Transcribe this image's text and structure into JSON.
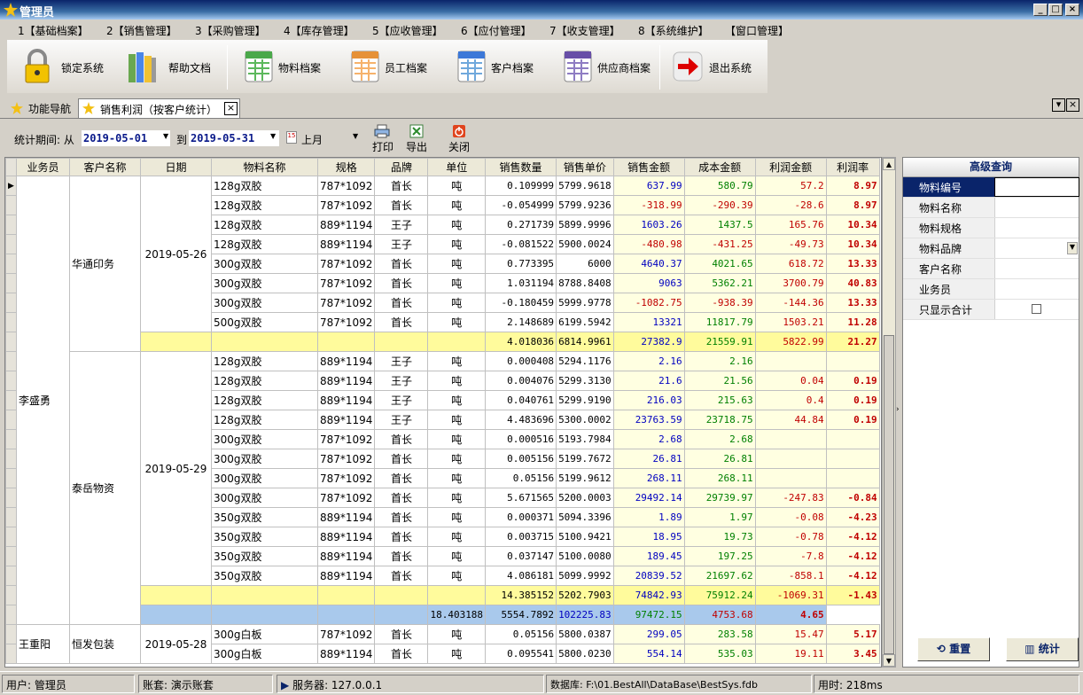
{
  "window": {
    "title": "管理员"
  },
  "menu": [
    "1【基础档案】",
    "2【销售管理】",
    "3【采购管理】",
    "4【库存管理】",
    "5【应收管理】",
    "6【应付管理】",
    "7【收支管理】",
    "8【系统维护】",
    "【窗口管理】"
  ],
  "toolbar": [
    {
      "label": "锁定系统",
      "icon": "lock-icon"
    },
    {
      "label": "帮助文档",
      "icon": "books-icon"
    },
    {
      "label": "物料档案",
      "icon": "spreadsheet-green-icon"
    },
    {
      "label": "员工档案",
      "icon": "spreadsheet-orange-icon"
    },
    {
      "label": "客户档案",
      "icon": "spreadsheet-blue-icon"
    },
    {
      "label": "供应商档案",
      "icon": "spreadsheet-purple-icon"
    },
    {
      "label": "退出系统",
      "icon": "exit-arrow-icon"
    }
  ],
  "tabs": [
    {
      "label": "功能导航"
    },
    {
      "label": "销售利润（按客户统计）"
    }
  ],
  "filter": {
    "period_label": "统计期间: 从",
    "from": "2019-05-01",
    "to_label": "到",
    "to": "2019-05-31",
    "preset": "上月",
    "print": "打印",
    "export": "导出",
    "close": "关闭"
  },
  "grid": {
    "columns": [
      "业务员",
      "客户名称",
      "日期",
      "物料名称",
      "规格",
      "品牌",
      "单位",
      "销售数量",
      "销售单价",
      "销售金额",
      "成本金额",
      "利润金额",
      "利润率"
    ],
    "groups": [
      {
        "salesman": "李盛勇",
        "customers": [
          {
            "name": "华通印务",
            "date": "2019-05-26",
            "rows": [
              [
                "128g双胶",
                "787*1092",
                "首长",
                "吨",
                "0.109999",
                "5799.9618",
                "637.99",
                "580.79",
                "57.2",
                "8.97"
              ],
              [
                "128g双胶",
                "787*1092",
                "首长",
                "吨",
                "-0.054999",
                "5799.9236",
                "-318.99",
                "-290.39",
                "-28.6",
                "8.97"
              ],
              [
                "128g双胶",
                "889*1194",
                "王子",
                "吨",
                "0.271739",
                "5899.9996",
                "1603.26",
                "1437.5",
                "165.76",
                "10.34"
              ],
              [
                "128g双胶",
                "889*1194",
                "王子",
                "吨",
                "-0.081522",
                "5900.0024",
                "-480.98",
                "-431.25",
                "-49.73",
                "10.34"
              ],
              [
                "300g双胶",
                "787*1092",
                "首长",
                "吨",
                "0.773395",
                "6000",
                "4640.37",
                "4021.65",
                "618.72",
                "13.33"
              ],
              [
                "300g双胶",
                "787*1092",
                "首长",
                "吨",
                "1.031194",
                "8788.8408",
                "9063",
                "5362.21",
                "3700.79",
                "40.83"
              ],
              [
                "300g双胶",
                "787*1092",
                "首长",
                "吨",
                "-0.180459",
                "5999.9778",
                "-1082.75",
                "-938.39",
                "-144.36",
                "13.33"
              ],
              [
                "500g双胶",
                "787*1092",
                "首长",
                "吨",
                "2.148689",
                "6199.5942",
                "13321",
                "11817.79",
                "1503.21",
                "11.28"
              ]
            ],
            "subtotal": [
              "4.018036",
              "6814.9961",
              "27382.9",
              "21559.91",
              "5822.99",
              "21.27"
            ]
          },
          {
            "name": "泰岳物资",
            "date": "2019-05-29",
            "rows": [
              [
                "128g双胶",
                "889*1194",
                "王子",
                "吨",
                "0.000408",
                "5294.1176",
                "2.16",
                "2.16",
                "",
                ""
              ],
              [
                "128g双胶",
                "889*1194",
                "王子",
                "吨",
                "0.004076",
                "5299.3130",
                "21.6",
                "21.56",
                "0.04",
                "0.19"
              ],
              [
                "128g双胶",
                "889*1194",
                "王子",
                "吨",
                "0.040761",
                "5299.9190",
                "216.03",
                "215.63",
                "0.4",
                "0.19"
              ],
              [
                "128g双胶",
                "889*1194",
                "王子",
                "吨",
                "4.483696",
                "5300.0002",
                "23763.59",
                "23718.75",
                "44.84",
                "0.19"
              ],
              [
                "300g双胶",
                "787*1092",
                "首长",
                "吨",
                "0.000516",
                "5193.7984",
                "2.68",
                "2.68",
                "",
                ""
              ],
              [
                "300g双胶",
                "787*1092",
                "首长",
                "吨",
                "0.005156",
                "5199.7672",
                "26.81",
                "26.81",
                "",
                ""
              ],
              [
                "300g双胶",
                "787*1092",
                "首长",
                "吨",
                "0.05156",
                "5199.9612",
                "268.11",
                "268.11",
                "",
                ""
              ],
              [
                "300g双胶",
                "787*1092",
                "首长",
                "吨",
                "5.671565",
                "5200.0003",
                "29492.14",
                "29739.97",
                "-247.83",
                "-0.84"
              ],
              [
                "350g双胶",
                "889*1194",
                "首长",
                "吨",
                "0.000371",
                "5094.3396",
                "1.89",
                "1.97",
                "-0.08",
                "-4.23"
              ],
              [
                "350g双胶",
                "889*1194",
                "首长",
                "吨",
                "0.003715",
                "5100.9421",
                "18.95",
                "19.73",
                "-0.78",
                "-4.12"
              ],
              [
                "350g双胶",
                "889*1194",
                "首长",
                "吨",
                "0.037147",
                "5100.0080",
                "189.45",
                "197.25",
                "-7.8",
                "-4.12"
              ],
              [
                "350g双胶",
                "889*1194",
                "首长",
                "吨",
                "4.086181",
                "5099.9992",
                "20839.52",
                "21697.62",
                "-858.1",
                "-4.12"
              ]
            ],
            "subtotal": [
              "14.385152",
              "5202.7903",
              "74842.93",
              "75912.24",
              "-1069.31",
              "-1.43"
            ]
          }
        ],
        "total": [
          "18.403188",
          "5554.7892",
          "102225.83",
          "97472.15",
          "4753.68",
          "4.65"
        ]
      },
      {
        "salesman": "王重阳",
        "customers": [
          {
            "name": "恒发包装",
            "date": "2019-05-28",
            "rows": [
              [
                "300g白板",
                "787*1092",
                "首长",
                "吨",
                "0.05156",
                "5800.0387",
                "299.05",
                "283.58",
                "15.47",
                "5.17"
              ],
              [
                "300g白板",
                "889*1194",
                "首长",
                "吨",
                "0.095541",
                "5800.0230",
                "554.14",
                "535.03",
                "19.11",
                "3.45"
              ]
            ]
          }
        ]
      }
    ]
  },
  "panel": {
    "title": "高级查询",
    "fields": [
      "物料编号",
      "物料名称",
      "物料规格",
      "物料品牌",
      "客户名称",
      "业务员",
      "只显示合计"
    ],
    "reset": "重置",
    "stats": "统计"
  },
  "status": {
    "user": "用户: 管理员",
    "account": "账套: 演示账套",
    "server": "服务器: 127.0.0.1",
    "database": "数据库: F:\\01.BestAll\\DataBase\\BestSys.fdb",
    "time": "用时: 218ms"
  },
  "colors": {
    "title_bar": "#0a246a",
    "subtotal_row": "#fffb9c",
    "total_row": "#a9c9ec",
    "amount_bg": "#ffffe1",
    "negative": "#c00000"
  }
}
